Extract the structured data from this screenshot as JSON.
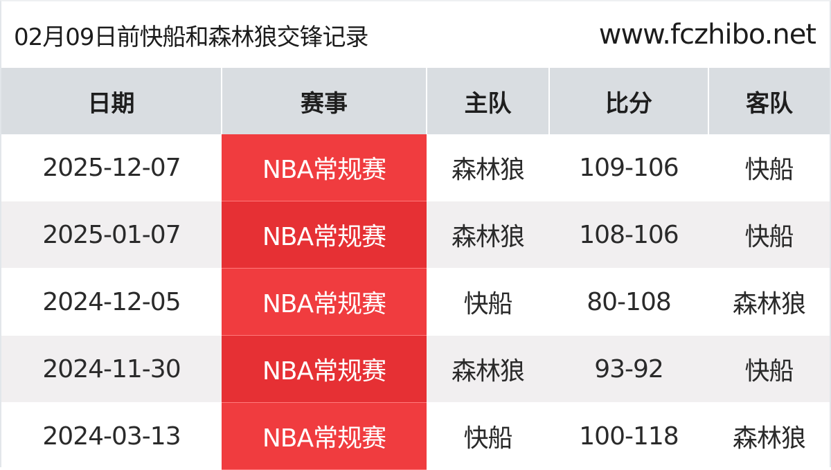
{
  "header": {
    "title": "02月09日前快船和森林狼交锋记录",
    "site": "www.fczhibo.net"
  },
  "table": {
    "columns": [
      "日期",
      "赛事",
      "主队",
      "比分",
      "客队"
    ],
    "rows": [
      {
        "date": "2025-12-07",
        "event": "NBA常规赛",
        "home": "森林狼",
        "score": "109-106",
        "away": "快船"
      },
      {
        "date": "2025-01-07",
        "event": "NBA常规赛",
        "home": "森林狼",
        "score": "108-106",
        "away": "快船"
      },
      {
        "date": "2024-12-05",
        "event": "NBA常规赛",
        "home": "快船",
        "score": "80-108",
        "away": "森林狼"
      },
      {
        "date": "2024-11-30",
        "event": "NBA常规赛",
        "home": "森林狼",
        "score": "93-92",
        "away": "快船"
      },
      {
        "date": "2024-03-13",
        "event": "NBA常规赛",
        "home": "快船",
        "score": "100-118",
        "away": "森林狼"
      }
    ]
  },
  "colors": {
    "header_bg": "#d9dde1",
    "event_bg": "#f03c3f",
    "row_alt_bg": "#f1eff0"
  }
}
